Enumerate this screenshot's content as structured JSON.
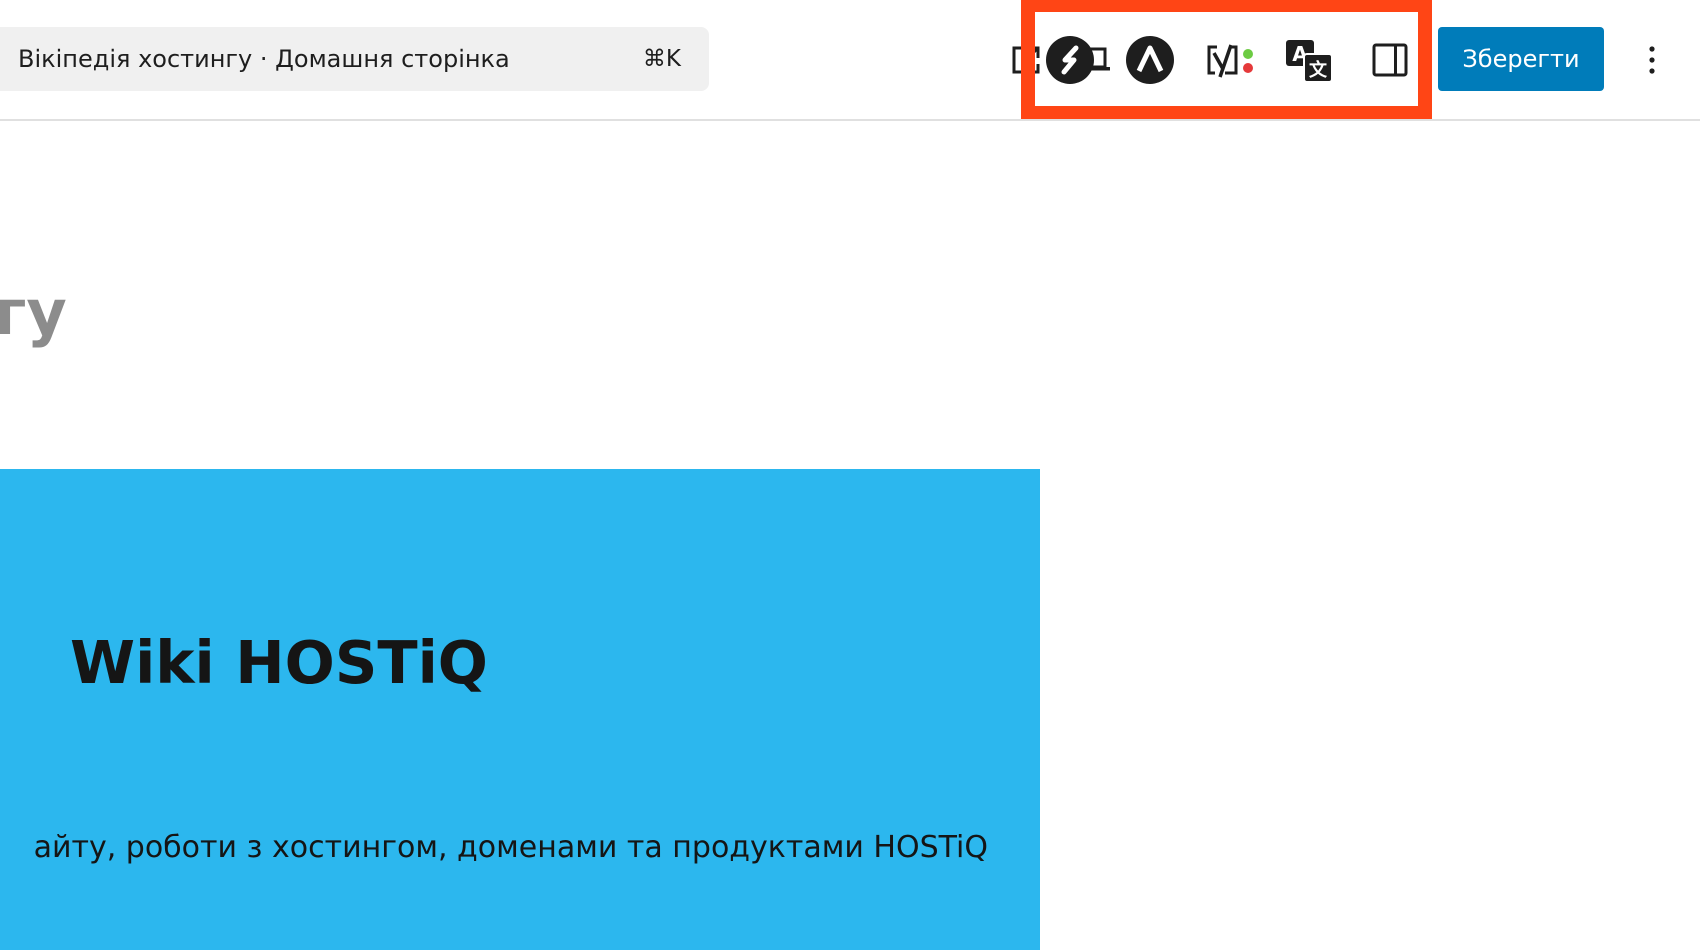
{
  "toolbar": {
    "command_bar": {
      "title": "Вікіпедія хостингу · Домашня сторінка",
      "shortcut": "⌘K"
    },
    "buttons": [
      {
        "name": "view-page",
        "icon": "external-link-icon"
      },
      {
        "name": "preview",
        "icon": "desktop-icon"
      }
    ],
    "plugins": [
      {
        "name": "spectra",
        "icon": "spectra-icon"
      },
      {
        "name": "astra",
        "icon": "astra-icon"
      },
      {
        "name": "yoast-seo",
        "icon": "yoast-icon"
      },
      {
        "name": "translate",
        "icon": "translate-icon"
      },
      {
        "name": "settings-sidebar",
        "icon": "sidebar-toggle-icon"
      }
    ],
    "save_label": "Зберегти",
    "options_icon": "more-vertical-icon",
    "highlight_color": "#ff4515",
    "save_color": "#007cba"
  },
  "content": {
    "heading_fragment": "гу",
    "hero": {
      "background": "#2cb7ee",
      "title": "Wiki HOSTiQ",
      "text": "айту, роботи з хостингом, доменами та продуктами HOSTiQ"
    }
  }
}
